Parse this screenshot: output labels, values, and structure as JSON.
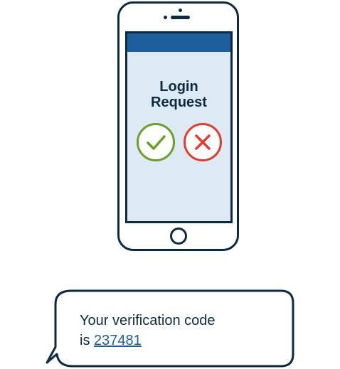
{
  "login": {
    "title_line1": "Login",
    "title_line2": "Request",
    "approve_icon": "check-icon",
    "deny_icon": "x-icon"
  },
  "message": {
    "line1": "Your verification code",
    "line2_prefix": "is ",
    "code": "237481"
  },
  "colors": {
    "outline": "#0d2a3f",
    "header": "#1c5f9c",
    "screen": "#dde9f3",
    "approve": "#6a9f2a",
    "deny": "#e23b2f",
    "code_link": "#1c5f9c"
  }
}
